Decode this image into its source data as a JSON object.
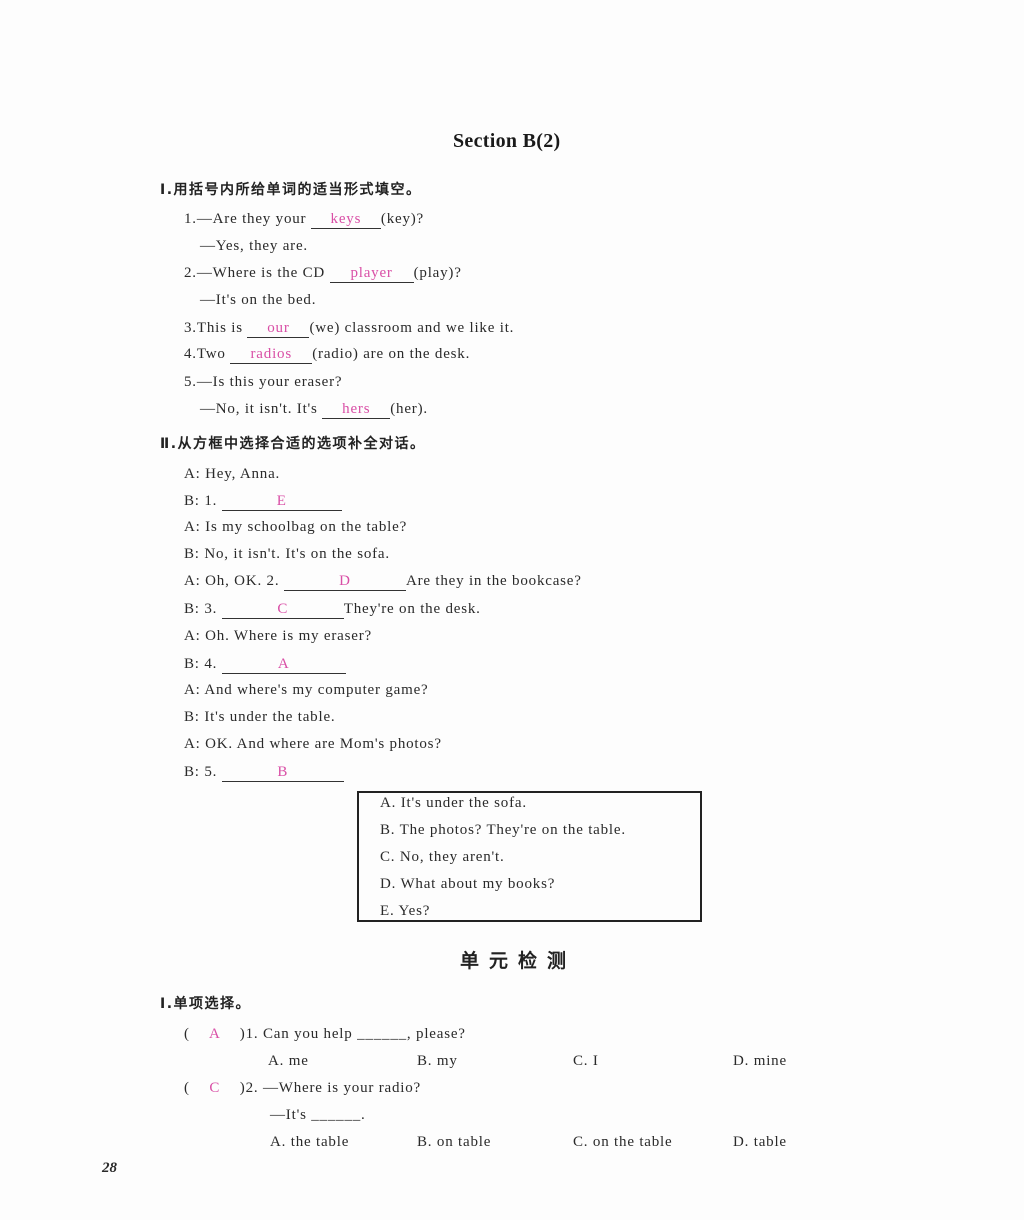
{
  "section_title": "Section B(2)",
  "part1": {
    "heading": "Ⅰ.用括号内所给单词的适当形式填空。",
    "items": [
      {
        "pre": "1.—Are they your ",
        "answer": "keys",
        "post": "(key)?"
      },
      {
        "line": "—Yes, they are."
      },
      {
        "pre": "2.—Where is the CD ",
        "answer": "player",
        "post": "(play)?"
      },
      {
        "line": "—It's on the bed."
      },
      {
        "pre": "3.This is ",
        "answer": "our",
        "post": "(we) classroom and we like it."
      },
      {
        "pre": "4.Two ",
        "answer": "radios",
        "post": "(radio) are on the desk."
      },
      {
        "line": "5.—Is this your eraser?"
      },
      {
        "pre": "—No, it isn't. It's ",
        "answer": "hers",
        "post": "(her)."
      }
    ]
  },
  "part2": {
    "heading": "Ⅱ.从方框中选择合适的选项补全对话。",
    "dialogue": [
      {
        "text": "A: Hey, Anna."
      },
      {
        "pre": "B: 1. ",
        "answer": "E",
        "post": ""
      },
      {
        "text": "A: Is my schoolbag on the table?"
      },
      {
        "text": "B: No, it isn't. It's on the sofa."
      },
      {
        "pre": "A: Oh, OK. 2. ",
        "answer": "D",
        "post": "Are they in the bookcase?"
      },
      {
        "pre": "B: 3. ",
        "answer": "C",
        "post": "They're on the desk."
      },
      {
        "text": "A: Oh. Where is my eraser?"
      },
      {
        "pre": "B: 4. ",
        "answer": "A",
        "post": ""
      },
      {
        "text": "A: And where's my computer game?"
      },
      {
        "text": "B: It's under the table."
      },
      {
        "text": "A: OK. And where are Mom's photos?"
      },
      {
        "pre": "B: 5. ",
        "answer": "B",
        "post": ""
      }
    ],
    "options": [
      "A. It's under the sofa.",
      "B. The photos? They're on the table.",
      "C. No, they aren't.",
      "D. What about my books?",
      "E. Yes?"
    ]
  },
  "unit_test": {
    "title": "单元检测",
    "heading": "Ⅰ.单项选择。",
    "questions": [
      {
        "answer": "A",
        "stem": ")1. Can you help ______, please?",
        "options": [
          "A. me",
          "B. my",
          "C. I",
          "D. mine"
        ]
      },
      {
        "answer": "C",
        "stem": ")2. —Where is your radio?",
        "stem2": "—It's ______.",
        "options": [
          "A. the table",
          "B. on table",
          "C. on the table",
          "D. table"
        ]
      }
    ]
  },
  "page_number": "28",
  "colors": {
    "answer_pink": "#d94fa6"
  }
}
